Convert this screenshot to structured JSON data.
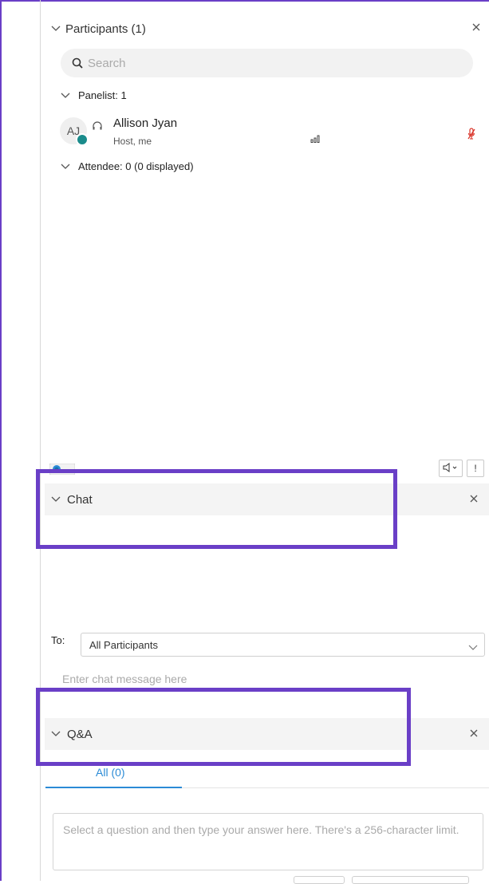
{
  "participants": {
    "title": "Participants (1)",
    "search_placeholder": "Search",
    "panelist_group": "Panelist: 1",
    "attendee_group": "Attendee: 0 (0 displayed)",
    "person": {
      "initials": "AJ",
      "name": "Allison Jyan",
      "role": "Host, me"
    },
    "toolbar": {
      "feedback_label": "!"
    }
  },
  "chat": {
    "title": "Chat",
    "to_label": "To:",
    "to_value": "All Participants",
    "input_placeholder": "Enter chat message here"
  },
  "qa": {
    "title": "Q&A",
    "tab_all": "All (0)",
    "answer_placeholder": "Select a question and then type your answer here. There's a 256-character limit."
  },
  "colors": {
    "highlight_box": "#6a3fc7",
    "accent_blue": "#2b8bd6",
    "muted_mic_red": "#d93025"
  }
}
